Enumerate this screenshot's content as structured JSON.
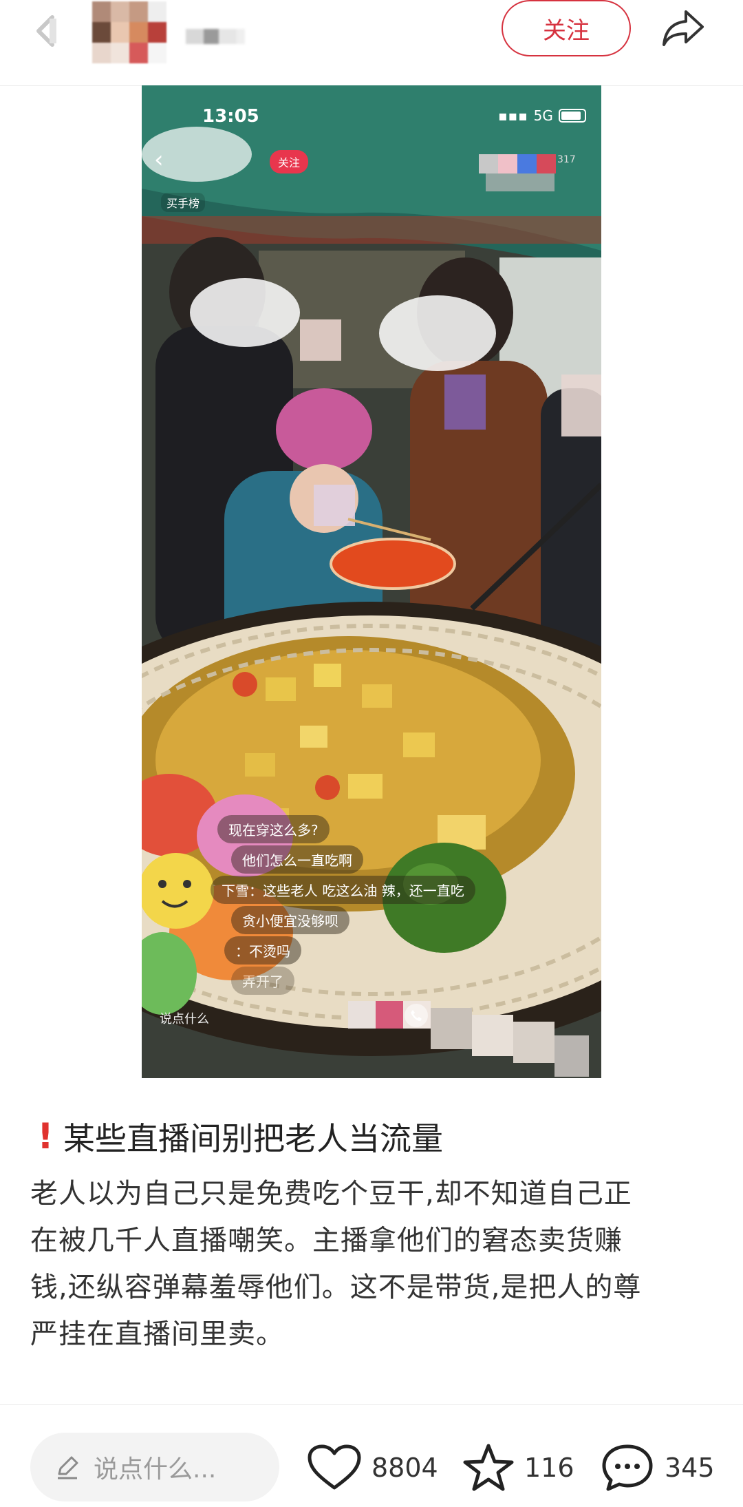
{
  "header": {
    "follow_label": "关注",
    "back_icon": "chevron-left-icon",
    "share_icon": "share-arrow-icon"
  },
  "media": {
    "status_time": "13:05",
    "status_network": "5G",
    "inner_follow_label": "关注",
    "inner_rank_label": "买手榜",
    "inner_viewers": "317",
    "danmaku": [
      "现在穿这么多?",
      "他们怎么一直吃啊",
      "下雪：这些老人 吃这么油 辣，还一直吃",
      "贪小便宜没够呗",
      "：不烫吗",
      "弄开了"
    ],
    "inner_input_placeholder": "说点什么"
  },
  "post": {
    "title_icon": "exclamation-icon",
    "title": "某些直播间别把老人当流量",
    "body_lines": [
      "老人以为自己只是免费吃个豆干,却不知道自己正",
      "在被几千人直播嘲笑。主播拿他们的窘态卖货赚",
      "钱,还纵容弹幕羞辱他们。这不是带货,是把人的尊",
      "严挂在直播间里卖。"
    ]
  },
  "bottom_bar": {
    "comment_placeholder": "说点什么...",
    "likes": "8804",
    "favorites": "116",
    "comments": "345"
  },
  "colors": {
    "accent": "#d6323f",
    "text": "#222222",
    "muted": "#9a9a9a"
  }
}
